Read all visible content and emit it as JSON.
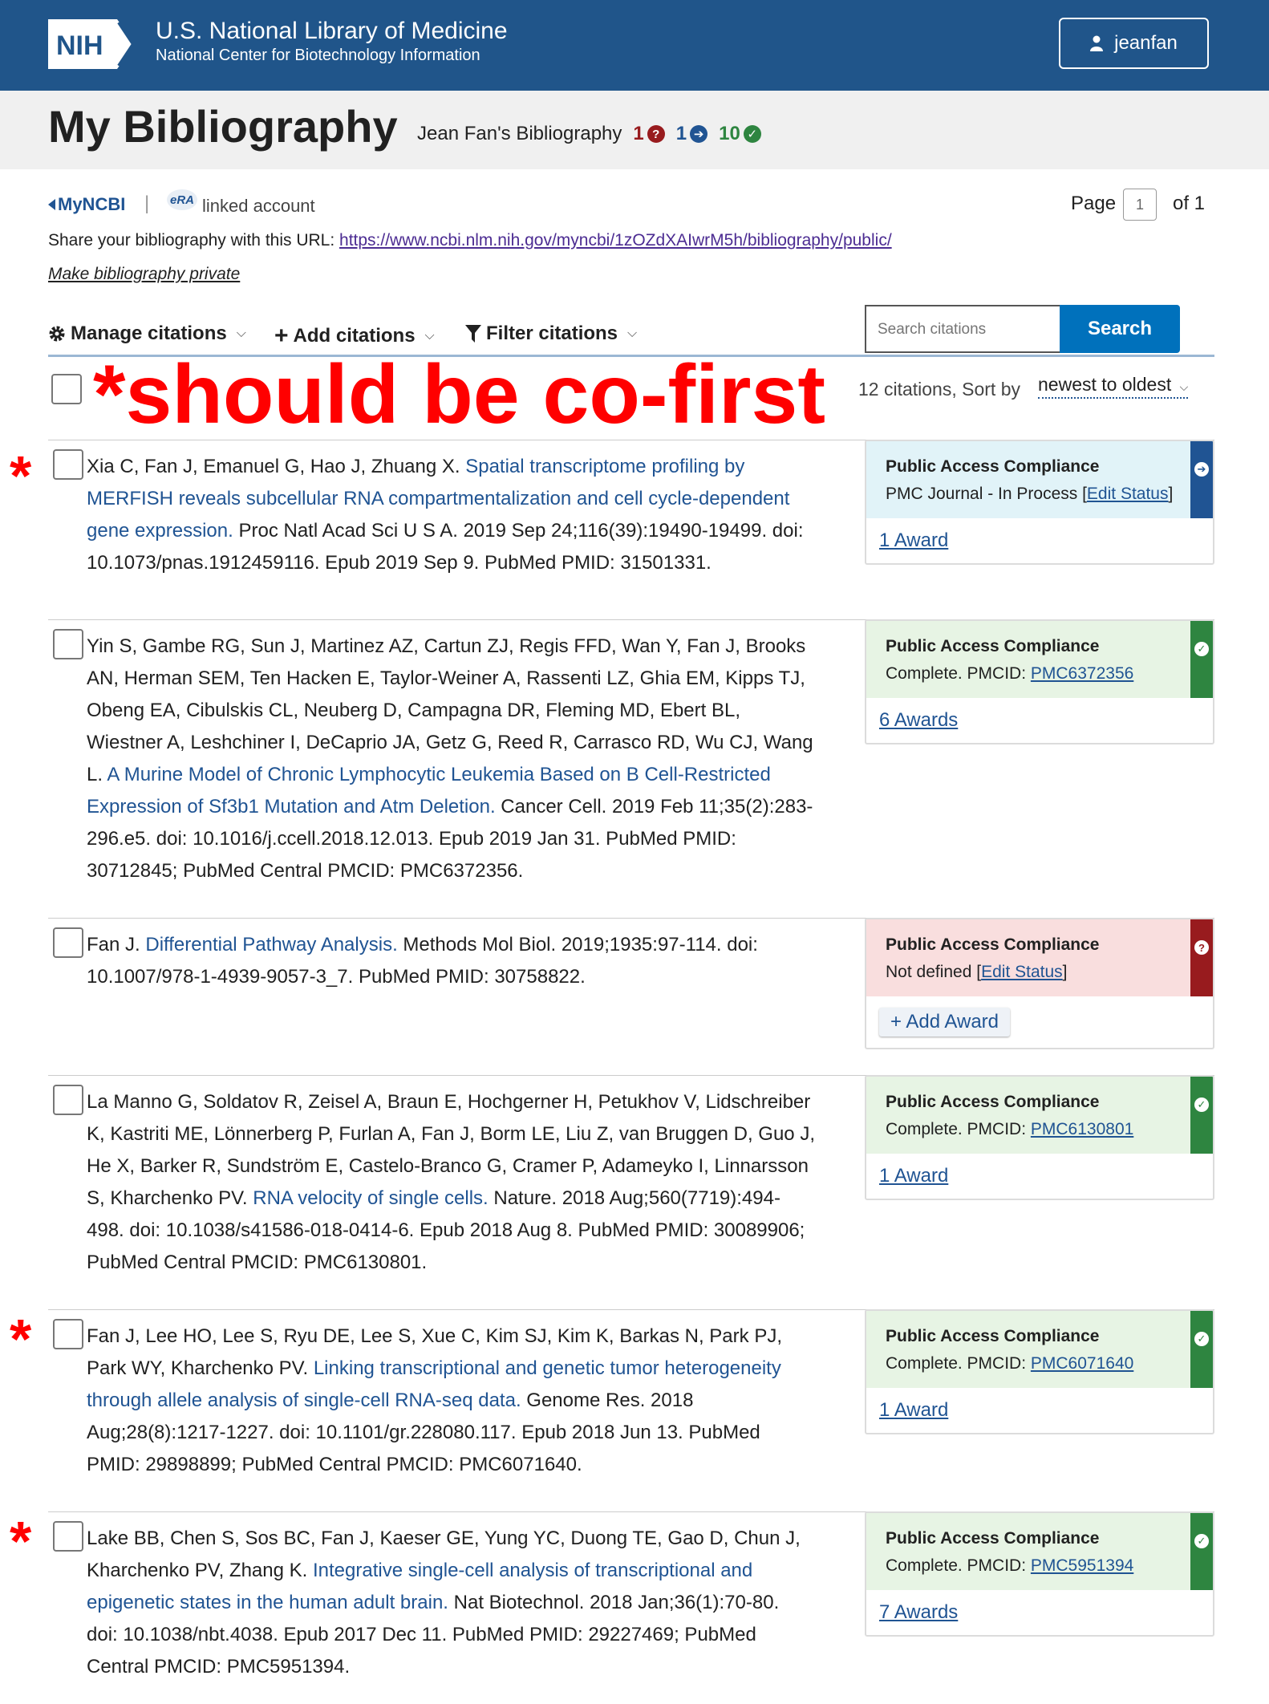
{
  "header": {
    "logo_text": "NIH",
    "org_title": "U.S. National Library of Medicine",
    "org_subtitle": "National Center for Biotechnology Information",
    "username": "jeanfan"
  },
  "titlebar": {
    "title": "My Bibliography",
    "subtitle": "Jean Fan's Bibliography",
    "stats": {
      "not_defined": "1",
      "in_process": "1",
      "complete": "10"
    }
  },
  "subbar": {
    "myncbi": "MyNCBI",
    "separator": "|",
    "era_logo": "eRA",
    "linked": "linked account",
    "page_label": "Page",
    "page_value": "1",
    "page_of": "of 1",
    "share_label": "Share your bibliography with this URL: ",
    "share_url": "https://www.ncbi.nlm.nih.gov/myncbi/1zOZdXAIwrM5h/bibliography/public/",
    "make_private": "Make bibliography private"
  },
  "toolbar": {
    "manage": "Manage citations",
    "add": "Add citations",
    "filter": "Filter citations",
    "search_placeholder": "Search citations",
    "search_button": "Search"
  },
  "annotation": "*should be co-first",
  "list": {
    "count_sort": "12 citations, Sort by",
    "sort_value": "newest to oldest"
  },
  "citations": [
    {
      "starred": true,
      "authors": "Xia C, Fan J, Emanuel G, Hao J, Zhuang X. ",
      "title": "Spatial transcriptome profiling by MERFISH reveals subcellular RNA compartmentalization and cell cycle-dependent gene expression.",
      "rest": " Proc Natl Acad Sci U S A. 2019 Sep 24;116(39):19490-19499. doi: 10.1073/pnas.1912459116. Epub 2019 Sep 9. PubMed PMID: 31501331.",
      "pac_heading": "Public Access Compliance",
      "pac_text": "PMC Journal - In Process [",
      "pac_link": "Edit Status",
      "pac_end": "]",
      "status": "blue",
      "award": "1 Award"
    },
    {
      "starred": false,
      "authors": "Yin S, Gambe RG, Sun J, Martinez AZ, Cartun ZJ, Regis FFD, Wan Y, Fan J, Brooks AN, Herman SEM, Ten Hacken E, Taylor-Weiner A, Rassenti LZ, Ghia EM, Kipps TJ, Obeng EA, Cibulskis CL, Neuberg D, Campagna DR, Fleming MD, Ebert BL, Wiestner A, Leshchiner I, DeCaprio JA, Getz G, Reed R, Carrasco RD, Wu CJ, Wang L. ",
      "title": "A Murine Model of Chronic Lymphocytic Leukemia Based on B Cell-Restricted Expression of Sf3b1 Mutation and Atm Deletion.",
      "rest": " Cancer Cell. 2019 Feb 11;35(2):283-296.e5. doi: 10.1016/j.ccell.2018.12.013. Epub 2019 Jan 31. PubMed PMID: 30712845; PubMed Central PMCID: PMC6372356.",
      "pac_heading": "Public Access Compliance",
      "pac_text": "Complete. PMCID: ",
      "pac_link": "PMC6372356",
      "pac_end": "",
      "status": "green",
      "award": "6 Awards"
    },
    {
      "starred": false,
      "authors": "Fan J. ",
      "title": "Differential Pathway Analysis.",
      "rest": " Methods Mol Biol. 2019;1935:97-114. doi: 10.1007/978-1-4939-9057-3_7. PubMed PMID: 30758822.",
      "pac_heading": "Public Access Compliance",
      "pac_text": "Not defined [",
      "pac_link": "Edit Status",
      "pac_end": "]",
      "status": "red",
      "award": "Add Award"
    },
    {
      "starred": false,
      "authors": "La Manno G, Soldatov R, Zeisel A, Braun E, Hochgerner H, Petukhov V, Lidschreiber K, Kastriti ME, Lönnerberg P, Furlan A, Fan J, Borm LE, Liu Z, van Bruggen D, Guo J, He X, Barker R, Sundström E, Castelo-Branco G, Cramer P, Adameyko I, Linnarsson S, Kharchenko PV. ",
      "title": "RNA velocity of single cells.",
      "rest": " Nature. 2018 Aug;560(7719):494-498. doi: 10.1038/s41586-018-0414-6. Epub 2018 Aug 8. PubMed PMID: 30089906; PubMed Central PMCID: PMC6130801.",
      "pac_heading": "Public Access Compliance",
      "pac_text": "Complete. PMCID: ",
      "pac_link": "PMC6130801",
      "pac_end": "",
      "status": "green",
      "award": "1 Award"
    },
    {
      "starred": true,
      "authors": "Fan J, Lee HO, Lee S, Ryu DE, Lee S, Xue C, Kim SJ, Kim K, Barkas N, Park PJ, Park WY, Kharchenko PV. ",
      "title": "Linking transcriptional and genetic tumor heterogeneity through allele analysis of single-cell RNA-seq data.",
      "rest": " Genome Res. 2018 Aug;28(8):1217-1227. doi: 10.1101/gr.228080.117. Epub 2018 Jun 13. PubMed PMID: 29898899; PubMed Central PMCID: PMC6071640.",
      "pac_heading": "Public Access Compliance",
      "pac_text": "Complete. PMCID: ",
      "pac_link": "PMC6071640",
      "pac_end": "",
      "status": "green",
      "award": "1 Award"
    },
    {
      "starred": true,
      "authors": "Lake BB, Chen S, Sos BC, Fan J, Kaeser GE, Yung YC, Duong TE, Gao D, Chun J, Kharchenko PV, Zhang K. ",
      "title": "Integrative single-cell analysis of transcriptional and epigenetic states in the human adult brain.",
      "rest": " Nat Biotechnol. 2018 Jan;36(1):70-80. doi: 10.1038/nbt.4038. Epub 2017 Dec 11. PubMed PMID: 29227469; PubMed Central PMCID: PMC5951394.",
      "pac_heading": "Public Access Compliance",
      "pac_text": "Complete. PMCID: ",
      "pac_link": "PMC5951394",
      "pac_end": "",
      "status": "green",
      "award": "7 Awards"
    }
  ],
  "colors": {
    "header_bg": "#20558a",
    "link_blue": "#205493",
    "complete_green": "#2e8540",
    "not_defined_red": "#981b1e",
    "annotation_red": "#ff0000",
    "search_blue": "#0071bc"
  },
  "icons": {
    "user": "user-icon",
    "gear": "gear-icon",
    "plus": "plus-icon",
    "filter": "filter-icon",
    "caret_left": "caret-left-icon",
    "chevron_down": "chevron-down-icon",
    "question": "question-circle-icon",
    "arrow": "arrow-circle-icon",
    "check": "check-circle-icon"
  },
  "glyphs": {
    "chev": "⌵",
    "question": "?",
    "arrow": "➔",
    "check": "✓",
    "plus": "+",
    "star": "*"
  }
}
